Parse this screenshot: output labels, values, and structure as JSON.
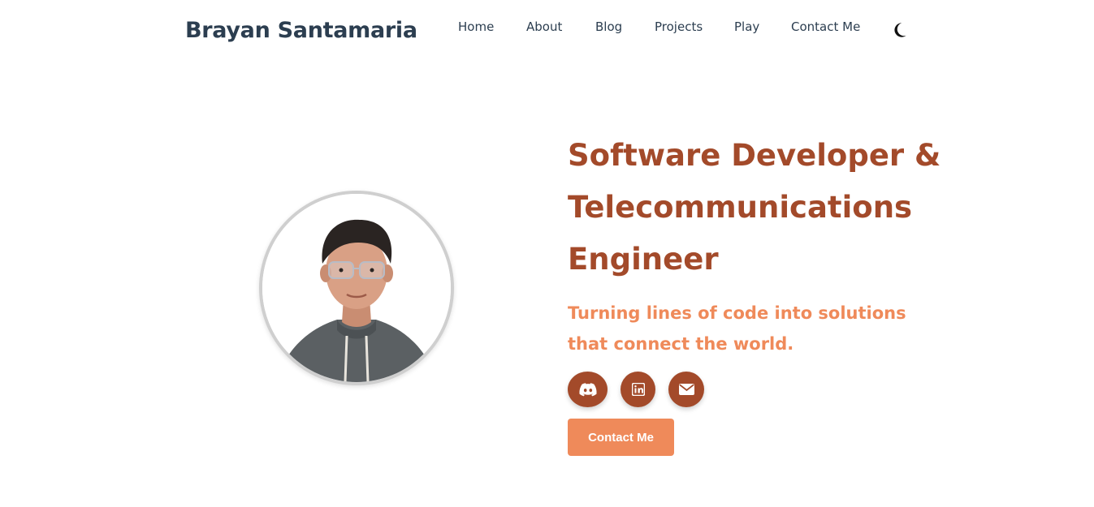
{
  "header": {
    "brand": "Brayan Santamaria",
    "nav": [
      "Home",
      "About",
      "Blog",
      "Projects",
      "Play",
      "Contact Me"
    ],
    "theme_icon": "moon-icon"
  },
  "hero": {
    "headline_lines": [
      "Software Developer &",
      "Telecommunications",
      "Engineer"
    ],
    "tagline_lines": [
      "Turning lines of code into solutions",
      "that connect the world."
    ],
    "social": [
      {
        "name": "discord",
        "icon": "discord-icon"
      },
      {
        "name": "linkedin",
        "icon": "linkedin-icon"
      },
      {
        "name": "email",
        "icon": "envelope-icon"
      }
    ],
    "cta_label": "Contact Me"
  },
  "colors": {
    "brand_text": "#2c3e50",
    "headline": "#a34a2a",
    "tagline": "#ef8a5a",
    "social_bg": "#a34a2a",
    "cta_bg": "#ef8a5a"
  }
}
